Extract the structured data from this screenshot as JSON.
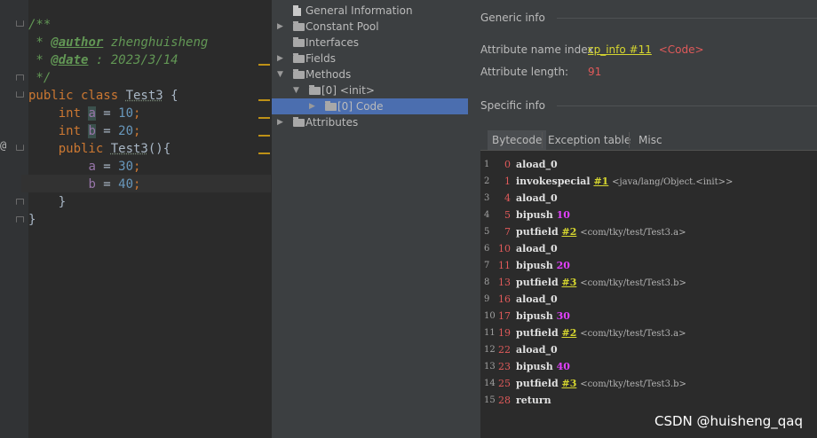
{
  "editor": {
    "lines": [
      {
        "segments": [
          {
            "t": "/**",
            "c": "c-com"
          }
        ]
      },
      {
        "segments": [
          {
            "t": " * ",
            "c": "c-com"
          },
          {
            "t": "@author",
            "c": "c-tag"
          },
          {
            "t": " zhenghuisheng",
            "c": "c-com"
          }
        ]
      },
      {
        "segments": [
          {
            "t": " * ",
            "c": "c-com"
          },
          {
            "t": "@date",
            "c": "c-tag"
          },
          {
            "t": " : 2023/3/14",
            "c": "c-com"
          }
        ]
      },
      {
        "segments": [
          {
            "t": " */",
            "c": "c-com"
          }
        ]
      },
      {
        "segments": [
          {
            "t": "public class ",
            "c": "c-kw"
          },
          {
            "t": "Test3",
            "c": "c-cls"
          },
          {
            "t": " {",
            "c": ""
          }
        ]
      },
      {
        "segments": [
          {
            "t": "    int ",
            "c": "c-kw"
          },
          {
            "t": "a",
            "c": "c-fld c-hlbox"
          },
          {
            "t": " = ",
            "c": ""
          },
          {
            "t": "10",
            "c": "c-num"
          },
          {
            "t": ";",
            "c": "c-kw"
          }
        ]
      },
      {
        "segments": [
          {
            "t": "    int ",
            "c": "c-kw"
          },
          {
            "t": "b",
            "c": "c-fld c-hlbox"
          },
          {
            "t": " = ",
            "c": ""
          },
          {
            "t": "20",
            "c": "c-num"
          },
          {
            "t": ";",
            "c": "c-kw"
          }
        ]
      },
      {
        "segments": [
          {
            "t": "    public ",
            "c": "c-kw"
          },
          {
            "t": "Test3",
            "c": "c-cls"
          },
          {
            "t": "(){",
            "c": ""
          }
        ]
      },
      {
        "segments": [
          {
            "t": "        ",
            "c": ""
          },
          {
            "t": "a",
            "c": "c-fld"
          },
          {
            "t": " = ",
            "c": ""
          },
          {
            "t": "30",
            "c": "c-num"
          },
          {
            "t": ";",
            "c": "c-kw"
          }
        ]
      },
      {
        "segments": [
          {
            "t": "        ",
            "c": ""
          },
          {
            "t": "b",
            "c": "c-fld"
          },
          {
            "t": " = ",
            "c": ""
          },
          {
            "t": "40",
            "c": "c-num"
          },
          {
            "t": ";",
            "c": "c-kw"
          }
        ]
      },
      {
        "segments": [
          {
            "t": "    }",
            "c": ""
          }
        ]
      },
      {
        "segments": [
          {
            "t": "}",
            "c": ""
          }
        ]
      }
    ],
    "override_marker": "@"
  },
  "tree": {
    "items": [
      {
        "label": "General Information",
        "icon": "file-icon",
        "arrow": ""
      },
      {
        "label": "Constant Pool",
        "icon": "folder-icon",
        "arrow": "collapsed"
      },
      {
        "label": "Interfaces",
        "icon": "folder-icon",
        "arrow": ""
      },
      {
        "label": "Fields",
        "icon": "folder-icon",
        "arrow": "collapsed"
      },
      {
        "label": "Methods",
        "icon": "folder-icon",
        "arrow": "expanded"
      },
      {
        "label": "[0] <init>",
        "icon": "folder-icon",
        "arrow": "expanded"
      },
      {
        "label": "[0] Code",
        "icon": "folder-icon",
        "arrow": "collapsed",
        "selected": true
      },
      {
        "label": "Attributes",
        "icon": "folder-icon",
        "arrow": "collapsed"
      }
    ]
  },
  "panel": {
    "generic_title": "Generic info",
    "name_index_label": "Attribute name index:",
    "name_index_link": "cp_info #11",
    "name_index_value": "<Code>",
    "length_label": "Attribute length:",
    "length_value": "91",
    "specific_title": "Specific info",
    "tabs": [
      "Bytecode",
      "Exception table",
      "Misc"
    ],
    "active_tab": 0
  },
  "bytecode": [
    {
      "line": "1",
      "offset": "0",
      "op": "aload_0"
    },
    {
      "line": "2",
      "offset": "1",
      "op": "invokespecial",
      "ref": "#1",
      "comment": "<java/lang/Object.<init>>"
    },
    {
      "line": "3",
      "offset": "4",
      "op": "aload_0"
    },
    {
      "line": "4",
      "offset": "5",
      "op": "bipush",
      "num": "10"
    },
    {
      "line": "5",
      "offset": "7",
      "op": "putfield",
      "ref": "#2",
      "comment": "<com/tky/test/Test3.a>"
    },
    {
      "line": "6",
      "offset": "10",
      "op": "aload_0"
    },
    {
      "line": "7",
      "offset": "11",
      "op": "bipush",
      "num": "20"
    },
    {
      "line": "8",
      "offset": "13",
      "op": "putfield",
      "ref": "#3",
      "comment": "<com/tky/test/Test3.b>"
    },
    {
      "line": "9",
      "offset": "16",
      "op": "aload_0"
    },
    {
      "line": "10",
      "offset": "17",
      "op": "bipush",
      "num": "30"
    },
    {
      "line": "11",
      "offset": "19",
      "op": "putfield",
      "ref": "#2",
      "comment": "<com/tky/test/Test3.a>"
    },
    {
      "line": "12",
      "offset": "22",
      "op": "aload_0"
    },
    {
      "line": "13",
      "offset": "23",
      "op": "bipush",
      "num": "40"
    },
    {
      "line": "14",
      "offset": "25",
      "op": "putfield",
      "ref": "#3",
      "comment": "<com/tky/test/Test3.b>"
    },
    {
      "line": "15",
      "offset": "28",
      "op": "return"
    }
  ],
  "watermark": "CSDN @huisheng_qaq",
  "colors": {
    "editor_bg": "#2b2b2b",
    "panel_bg": "#3c3f41",
    "selection": "#4b6eaf",
    "link": "#d6d62f",
    "offset_red": "#e05a5a",
    "number_magenta": "#e040fb"
  }
}
